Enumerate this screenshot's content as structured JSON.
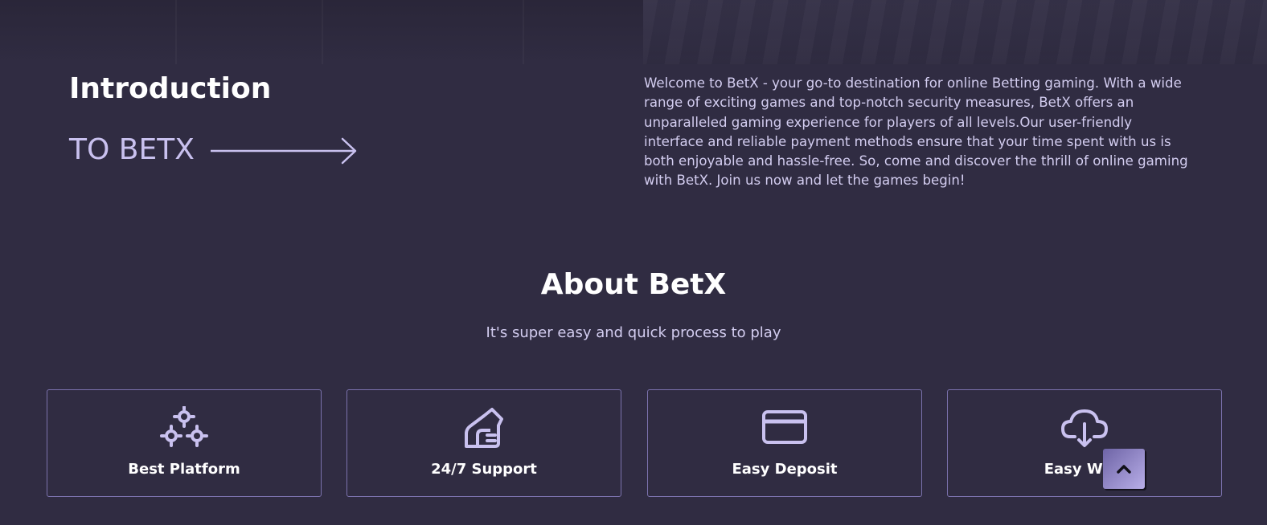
{
  "intro": {
    "title": "Introduction",
    "subtitle": "TO BETX",
    "text": "Welcome to BetX - your go-to destination for online Betting gaming. With a wide range of exciting games and top-notch security measures, BetX offers an unparalleled gaming experience for players of all levels.Our user-friendly interface and reliable payment methods ensure that your time spent with us is both enjoyable and hassle-free. So, come and discover the thrill of online gaming with BetX. Join us now and let the games begin!"
  },
  "about": {
    "title": "About BetX",
    "subtitle": "It's super easy and quick process to play"
  },
  "features": [
    {
      "label": "Best Platform",
      "icon": "gears-icon"
    },
    {
      "label": "24/7 Support",
      "icon": "support-hand-icon"
    },
    {
      "label": "Easy Deposit",
      "icon": "credit-card-icon"
    },
    {
      "label": "Easy With",
      "icon": "cloud-download-icon"
    }
  ],
  "colors": {
    "background": "#302c42",
    "accent": "#c9c1ef",
    "card_border": "#7b72ad"
  },
  "scroll_top": {
    "icon": "chevron-up-icon"
  }
}
